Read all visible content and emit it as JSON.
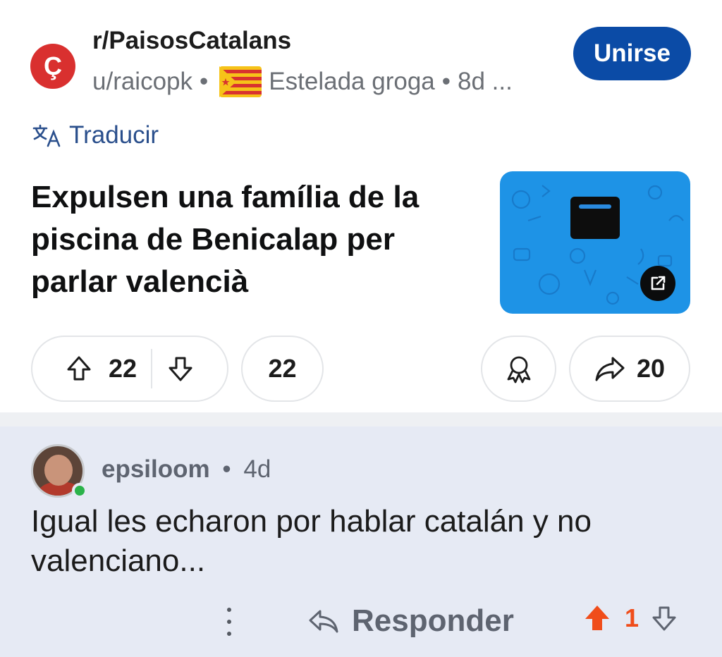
{
  "post": {
    "subreddit": "r/PaisosCatalans",
    "subreddit_icon": "Ç",
    "author": "u/raicopk",
    "separator": "•",
    "flair": "Estelada groga",
    "age": "8d ...",
    "join_label": "Unirse",
    "translate_label": "Traducir",
    "title": "Expulsen una família de la piscina de Benicalap per parlar valencià",
    "upvotes": "22",
    "comments": "22",
    "shares": "20",
    "colors": {
      "accent": "#0b4ba6",
      "subreddit_icon_bg": "#d9302f",
      "thumbnail_bg": "#1e93e6"
    }
  },
  "comment": {
    "author": "epsiloom",
    "separator": "•",
    "age": "4d",
    "body": "Igual les echaron por hablar catalán y no valenciano...",
    "reply_label": "Responder",
    "score": "1",
    "score_color": "#f04d1a",
    "status": "online"
  },
  "icons": [
    "translate-icon",
    "external-link-icon",
    "upvote-icon",
    "downvote-icon",
    "award-icon",
    "share-icon",
    "more-icon",
    "reply-icon",
    "flag-icon"
  ]
}
